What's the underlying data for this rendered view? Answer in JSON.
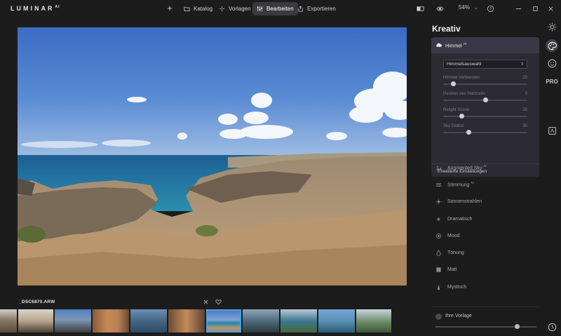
{
  "app": {
    "logo": "LUMINAR",
    "logo_suffix": "AI"
  },
  "toolbar": {
    "add_label": "+",
    "nav": [
      {
        "label": "Katalog",
        "icon": "folder-icon"
      },
      {
        "label": "Vorlagen",
        "icon": "sparkle-icon"
      },
      {
        "label": "Bearbeiten",
        "icon": "sliders-icon",
        "active": true
      },
      {
        "label": "Exportieren",
        "icon": "export-icon"
      }
    ],
    "zoom": "54%"
  },
  "image": {
    "filename": "_DSC6870.ARW",
    "description_colors": {
      "sky": "#3e73c6",
      "sea": "#1f6f9a",
      "rock": "#b59a7a"
    }
  },
  "panel": {
    "title": "Kreativ",
    "active_tool": "Himmel",
    "active_tool_suffix": "AI",
    "sky_select": "Himmelsauswahl",
    "sliders": [
      {
        "label": "Himmel Verblenden",
        "value": "20",
        "fraction": 0.1
      },
      {
        "label": "Position des Horizonts",
        "value": "0",
        "fraction": 0.5
      },
      {
        "label": "Relight Scene",
        "value": "20",
        "fraction": 0.2
      },
      {
        "label": "Sky Global",
        "value": "30",
        "fraction": 0.3
      }
    ],
    "advanced_label": "Erweiterte Einstellungen",
    "tools": [
      {
        "label": "Augmented Sky",
        "suffix": "AI",
        "icon": "cloud-landscape-icon"
      },
      {
        "label": "Stimmung",
        "suffix": "AI",
        "icon": "lines-icon"
      },
      {
        "label": "Sonnenstrahlen",
        "suffix": "",
        "icon": "sun-rays-icon"
      },
      {
        "label": "Dramatisch",
        "suffix": "",
        "icon": "lightning-icon"
      },
      {
        "label": "Mood",
        "suffix": "",
        "icon": "mood-icon"
      },
      {
        "label": "Tönung",
        "suffix": "",
        "icon": "toning-icon"
      },
      {
        "label": "Matt",
        "suffix": "",
        "icon": "matte-icon"
      },
      {
        "label": "Mystisch",
        "suffix": "",
        "icon": "mystic-icon"
      }
    ],
    "preset_label": "Ihre Vorlage",
    "preset_fraction": 0.8
  },
  "rail": {
    "pro_label": "PRO"
  },
  "colors": {
    "accent": "#4aa3df",
    "card": "#2c2b33",
    "card_head": "#3a3747"
  }
}
